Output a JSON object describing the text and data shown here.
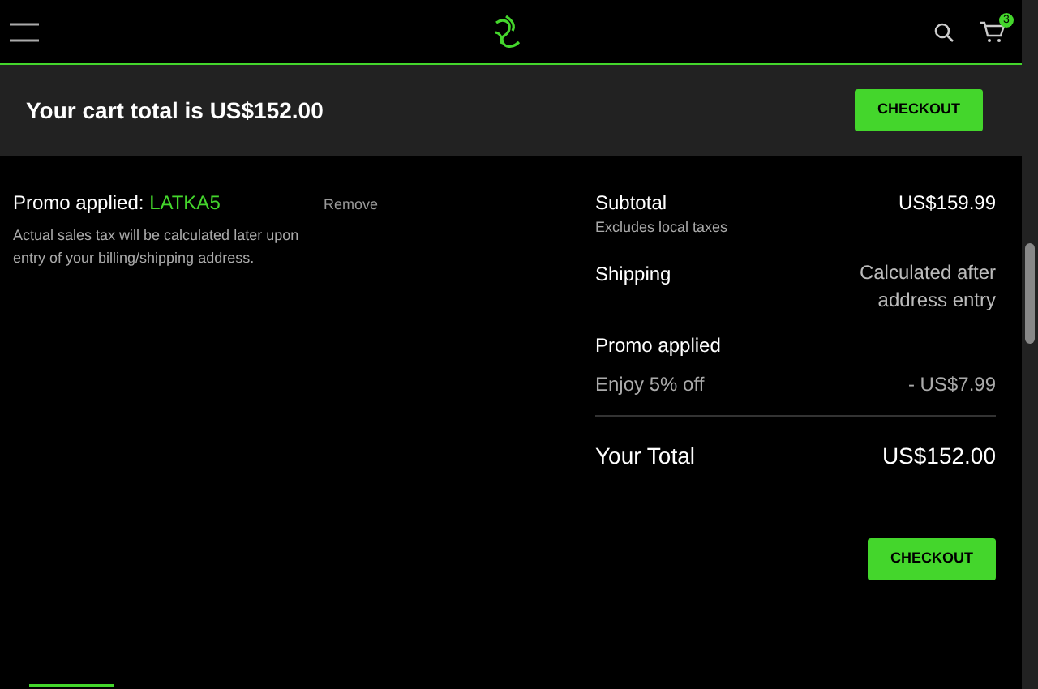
{
  "header": {
    "cart_count": "3"
  },
  "banner": {
    "title": "Your cart total is US$152.00",
    "button": "CHECKOUT"
  },
  "promo": {
    "label": "Promo applied:",
    "code": "LATKA5",
    "remove": "Remove",
    "note": "Actual sales tax will be calculated later upon entry of your billing/shipping address."
  },
  "summary": {
    "subtotal": {
      "label": "Subtotal",
      "sub": "Excludes local taxes",
      "value": "US$159.99"
    },
    "shipping": {
      "label": "Shipping",
      "value": "Calculated after address entry"
    },
    "promo": {
      "label": "Promo applied",
      "sub": "Enjoy 5% off",
      "value": "- US$7.99"
    },
    "total": {
      "label": "Your Total",
      "value": "US$152.00"
    }
  },
  "checkout_button": "CHECKOUT"
}
